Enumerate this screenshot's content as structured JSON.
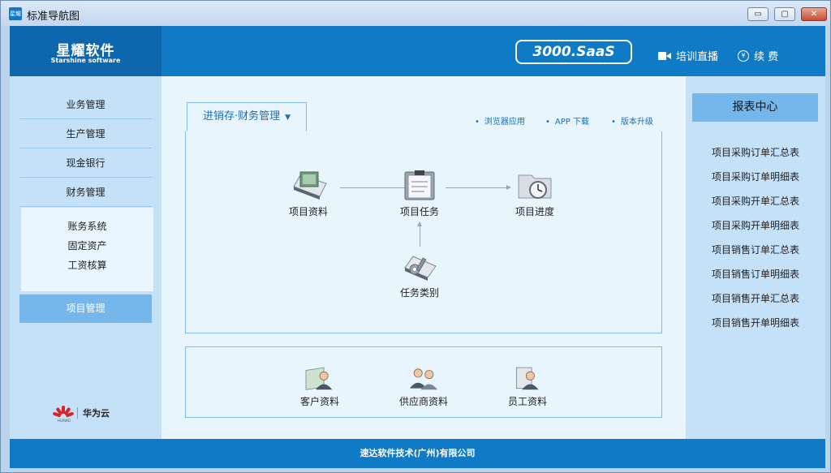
{
  "window": {
    "title": "标准导航图",
    "icon_text": "星耀",
    "controls": {
      "minimize": "▭",
      "maximize": "▢",
      "close": "✕"
    }
  },
  "header": {
    "logo_main": "星耀软件",
    "logo_sub": "Starshine software",
    "badge": "3000.SaaS",
    "live_label": "培训直播",
    "renew_label": "续 费"
  },
  "sidebar": {
    "items": [
      {
        "label": "业务管理"
      },
      {
        "label": "生产管理"
      },
      {
        "label": "现金银行"
      },
      {
        "label": "财务管理"
      }
    ],
    "sub_items": [
      {
        "label": "账务系统"
      },
      {
        "label": "固定资产"
      },
      {
        "label": "工资核算"
      }
    ],
    "active_item": "项目管理",
    "partner": {
      "name": "华为云",
      "logo_text": "HUAWEI"
    }
  },
  "main": {
    "tab_label": "进销存·财务管理",
    "links": [
      {
        "label": "浏览器应用"
      },
      {
        "label": "APP 下载"
      },
      {
        "label": "版本升级"
      }
    ],
    "flow_nodes": {
      "project_data": "项目资料",
      "project_task": "项目任务",
      "project_progress": "项目进度",
      "task_category": "任务类别"
    },
    "bottom_nodes": {
      "customer": "客户资料",
      "supplier": "供应商资料",
      "employee": "员工资料"
    }
  },
  "reports": {
    "title": "报表中心",
    "items": [
      {
        "label": "项目采购订单汇总表"
      },
      {
        "label": "项目采购订单明细表"
      },
      {
        "label": "项目采购开单汇总表"
      },
      {
        "label": "项目采购开单明细表"
      },
      {
        "label": "项目销售订单汇总表"
      },
      {
        "label": "项目销售订单明细表"
      },
      {
        "label": "项目销售开单汇总表"
      },
      {
        "label": "项目销售开单明细表"
      }
    ]
  },
  "footer": {
    "text": "速达软件技术(广州)有限公司"
  },
  "colors": {
    "header_blue": "#0f7bc6",
    "logo_blue": "#0e66ad",
    "sidebar_bg": "#c5e1f8",
    "active_bg": "#75b7ea",
    "main_bg": "#e9f5fd",
    "link_blue": "#1a6fb6"
  }
}
